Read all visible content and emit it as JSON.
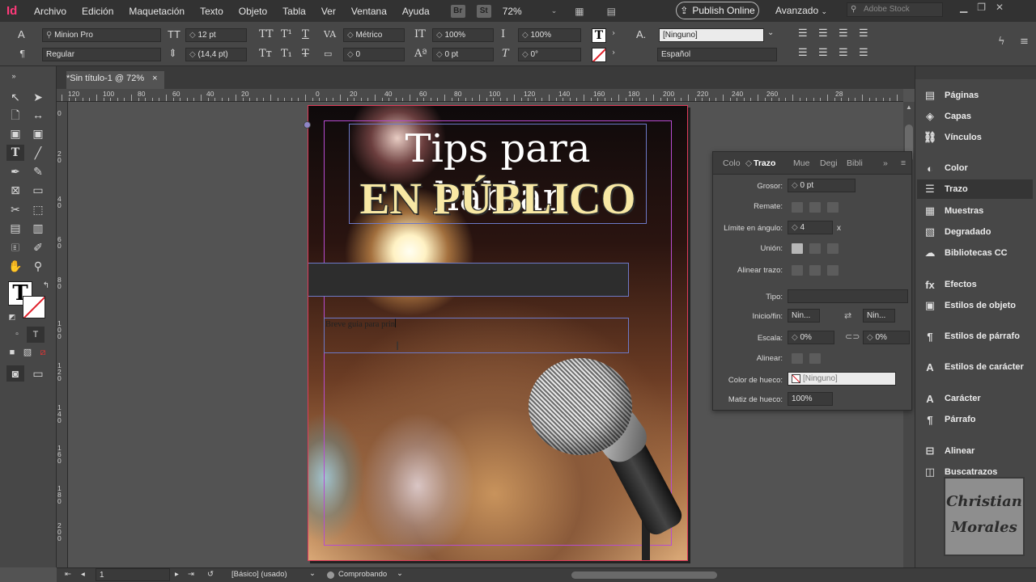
{
  "menubar": {
    "app_logo": "Id",
    "items": [
      "Archivo",
      "Edición",
      "Maquetación",
      "Texto",
      "Objeto",
      "Tabla",
      "Ver",
      "Ventana",
      "Ayuda"
    ],
    "bridge_label": "Br",
    "stock_label": "St",
    "zoom": "72%",
    "publish_label": "Publish Online",
    "workspace": "Avanzado",
    "search_placeholder": "Adobe Stock"
  },
  "control": {
    "font_family": "Minion Pro",
    "font_style": "Regular",
    "font_size": "12 pt",
    "leading": "(14,4 pt)",
    "kerning": "Métrico",
    "tracking": "0",
    "vscale": "100%",
    "hscale": "100%",
    "baseline": "0 pt",
    "skew": "0°",
    "char_style": "[Ninguno]",
    "language": "Español"
  },
  "document": {
    "tab_title": "*Sin título-1 @ 72%",
    "close": "×"
  },
  "rulers": {
    "h": [
      "120",
      "100",
      "80",
      "60",
      "40",
      "20",
      "0",
      "20",
      "40",
      "60",
      "80",
      "100",
      "120",
      "140",
      "160",
      "180",
      "200",
      "220",
      "240",
      "260",
      "28"
    ],
    "v": [
      "0",
      "2 0",
      "4 0",
      "6 0",
      "8 0",
      "1 0 0",
      "1 2 0",
      "1 4 0",
      "1 6 0",
      "1 8 0",
      "2 0 0"
    ]
  },
  "page": {
    "title_line1": "Tips para hablar",
    "title_line2": "EN PÚBLICO",
    "typed_text": "Breve guia para prin"
  },
  "stroke_panel": {
    "tabs": [
      "Colo",
      "Trazo",
      "Mue",
      "Degi",
      "Bibli"
    ],
    "active_tab": "Trazo",
    "weight_label": "Grosor:",
    "weight": "0 pt",
    "cap_label": "Remate:",
    "miter_label": "Límite en ángulo:",
    "miter": "4",
    "miter_unit": "x",
    "join_label": "Unión:",
    "align_label": "Alinear trazo:",
    "type_label": "Tipo:",
    "startend_label": "Inicio/fin:",
    "start": "Nin...",
    "end": "Nin...",
    "scale_label": "Escala:",
    "scale_start": "0%",
    "scale_end": "0%",
    "align2_label": "Alinear:",
    "gap_color_label": "Color de hueco:",
    "gap_color": "[Ninguno]",
    "gap_tint_label": "Matiz de hueco:",
    "gap_tint": "100%"
  },
  "dock": {
    "items": [
      {
        "icon": "pages-icon",
        "label": "Páginas"
      },
      {
        "icon": "layers-icon",
        "label": "Capas"
      },
      {
        "icon": "links-icon",
        "label": "Vínculos"
      },
      {
        "icon": "color-icon",
        "label": "Color"
      },
      {
        "icon": "stroke-icon",
        "label": "Trazo"
      },
      {
        "icon": "swatches-icon",
        "label": "Muestras"
      },
      {
        "icon": "gradient-icon",
        "label": "Degradado"
      },
      {
        "icon": "cc-libraries-icon",
        "label": "Bibliotecas CC"
      },
      {
        "icon": "effects-icon",
        "label": "Efectos"
      },
      {
        "icon": "object-styles-icon",
        "label": "Estilos de objeto"
      },
      {
        "icon": "paragraph-styles-icon",
        "label": "Estilos de párrafo"
      },
      {
        "icon": "character-styles-icon",
        "label": "Estilos de carácter"
      },
      {
        "icon": "character-icon",
        "label": "Carácter"
      },
      {
        "icon": "paragraph-icon",
        "label": "Párrafo"
      },
      {
        "icon": "align-icon",
        "label": "Alinear"
      },
      {
        "icon": "pathfinder-icon",
        "label": "Buscatrazos"
      }
    ],
    "active": "Trazo"
  },
  "watermark": {
    "line1": "Christian",
    "line2": "Morales"
  },
  "status": {
    "page": "1",
    "master": "[Básico] (usado)",
    "preflight": "Comprobando"
  },
  "colors": {
    "accent": "#ff3a7a",
    "guide": "#b74cd0",
    "frame": "#6d79c7",
    "bleed": "#e03b5a",
    "title_gold": "#f8e8a4"
  }
}
